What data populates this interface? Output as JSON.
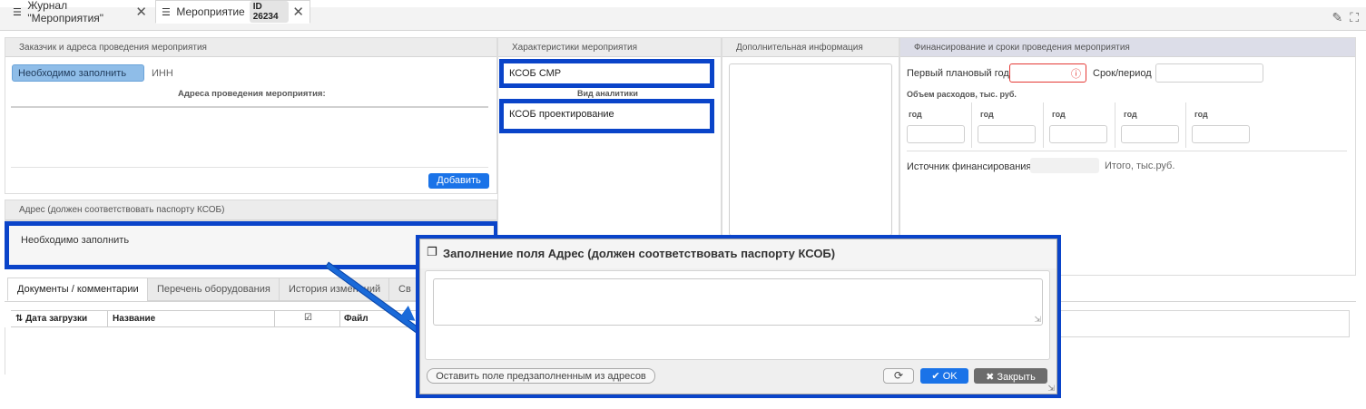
{
  "tabs": [
    {
      "label": "Журнал \"Мероприятия\""
    },
    {
      "label": "Мероприятие",
      "badge": "ID 26234"
    }
  ],
  "panel_customer": {
    "title": "Заказчик и адреса проведения мероприятия",
    "required_btn": "Необходимо заполнить",
    "inn_label": "ИНН",
    "addresses_label": "Адреса проведения мероприятия:",
    "add_btn": "Добавить"
  },
  "panel_address": {
    "title": "Адрес (должен соответствовать паспорту КСОБ)",
    "value": "Необходимо заполнить"
  },
  "panel_characteristics": {
    "title": "Характеристики мероприятия",
    "field1": "КСОБ СМР",
    "analytics_label": "Вид аналитики",
    "field2": "КСОБ проектирование"
  },
  "panel_extra": {
    "title": "Дополнительная информация"
  },
  "panel_finance": {
    "title": "Финансирование и сроки проведения мероприятия",
    "first_year_label": "Первый плановый год",
    "period_label": "Срок/период",
    "expenses_label": "Объем расходов, тыс. руб.",
    "year_label": "год",
    "source_label": "Источник финансирования",
    "total_label": "Итого, тыс.руб."
  },
  "doc_tabs": [
    "Документы / комментарии",
    "Перечень оборудования",
    "История изменений",
    "Св"
  ],
  "doc_table": {
    "columns": [
      "Дата загрузки",
      "Название",
      "Файл"
    ]
  },
  "modal": {
    "title": "Заполнение поля Адрес (должен соответствовать паспорту КСОБ)",
    "textarea_value": "",
    "prefill_btn": "Оставить поле предзаполненным из адресов",
    "ok_btn": "OK",
    "close_btn": "Закрыть"
  },
  "colors": {
    "highlight": "#0a44c9",
    "primary": "#1a73e8",
    "error": "#e53935"
  }
}
